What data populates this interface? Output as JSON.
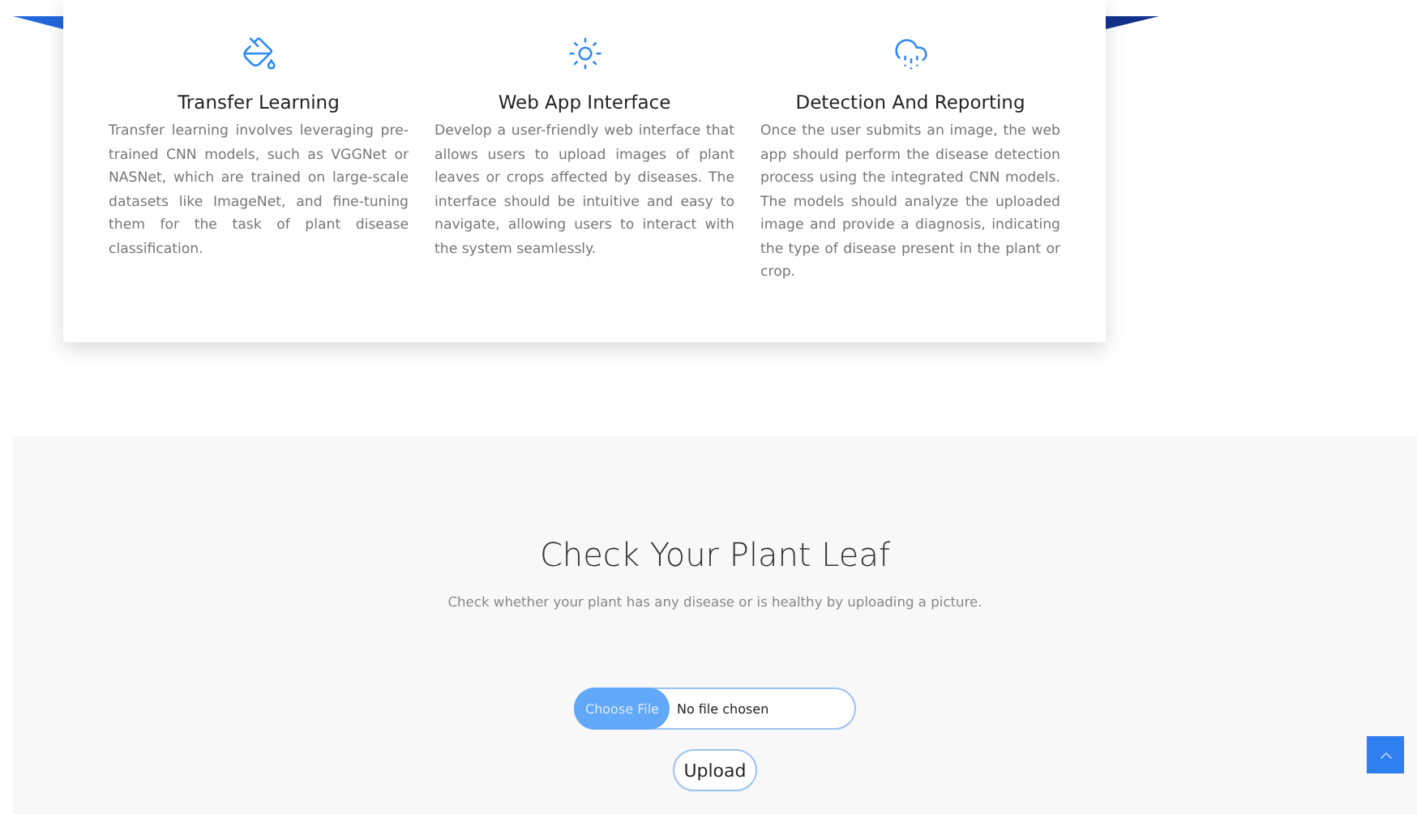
{
  "features": [
    {
      "title": "Transfer Learning",
      "text": "Transfer learning involves leveraging pre-trained CNN models, such as VGGNet or NASNet, which are trained on large-scale datasets like ImageNet, and fine-tuning them for the task of plant disease classification."
    },
    {
      "title": "Web App Interface",
      "text": "Develop a user-friendly web interface that allows users to upload images of plant leaves or crops affected by diseases. The interface should be intuitive and easy to navigate, allowing users to interact with the system seamlessly."
    },
    {
      "title": "Detection And Reporting",
      "text": "Once the user submits an image, the web app should perform the disease detection process using the integrated CNN models. The models should analyze the uploaded image and provide a diagnosis, indicating the type of disease present in the plant or crop."
    }
  ],
  "check": {
    "title": "Check Your Plant Leaf",
    "subtitle": "Check whether your plant has any disease or is healthy by uploading a picture.",
    "file_button": "Choose File",
    "file_status": "No file chosen",
    "upload_button": "Upload"
  }
}
